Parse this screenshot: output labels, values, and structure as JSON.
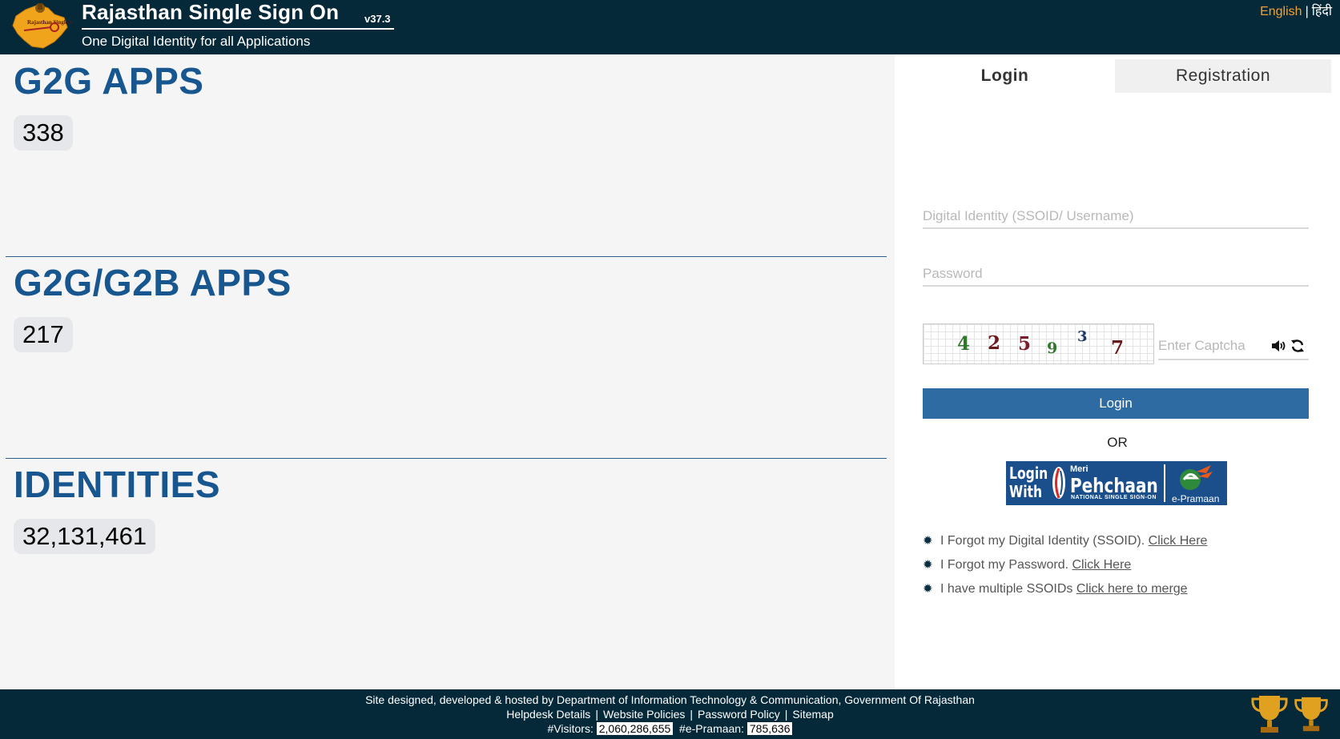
{
  "header": {
    "title": "Rajasthan Single Sign On",
    "version": "v37.3",
    "tagline": "One Digital Identity for all Applications",
    "logo_text": "Rajasthan Single Sign On",
    "lang_english": "English",
    "lang_hindi": "हिंदी",
    "lang_separator": "|"
  },
  "stats": [
    {
      "title": "G2G APPS",
      "count": "338"
    },
    {
      "title": "G2G/G2B APPS",
      "count": "217"
    },
    {
      "title": "IDENTITIES",
      "count": "32,131,461"
    }
  ],
  "login_panel": {
    "tab_login": "Login",
    "tab_registration": "Registration",
    "username_placeholder": "Digital Identity (SSOID/ Username)",
    "password_placeholder": "Password",
    "captcha_digits": [
      "4",
      "2",
      "5",
      "9",
      "3",
      "7"
    ],
    "captcha_placeholder": "Enter Captcha",
    "login_button": "Login",
    "or_text": "OR",
    "pehchaan": {
      "login_with_1": "Login",
      "login_with_2": "With",
      "meri": "Meri",
      "name": "Pehchaan",
      "subtitle": "NATIONAL SINGLE SIGN-ON",
      "epramaan": "e-Pramaan"
    },
    "help_links": [
      {
        "text": "I Forgot my Digital Identity (SSOID).",
        "link": "Click Here"
      },
      {
        "text": "I Forgot my Password.",
        "link": "Click Here"
      },
      {
        "text": "I have multiple SSOIDs",
        "link": "Click here to merge"
      }
    ]
  },
  "footer": {
    "credit": "Site designed, developed & hosted by Department of Information Technology & Communication, Government Of Rajasthan",
    "links": [
      "Helpdesk Details",
      "Website Policies",
      "Password Policy",
      "Sitemap"
    ],
    "visitors_label": "#Visitors:",
    "visitors_count": "2,060,286,655",
    "epramaan_label": "#e-Pramaan:",
    "epramaan_count": "785,636"
  },
  "colors": {
    "header_bg": "#06293a",
    "accent_blue": "#17568f",
    "button_blue": "#2e6ba2",
    "english_link": "#f0a030"
  }
}
